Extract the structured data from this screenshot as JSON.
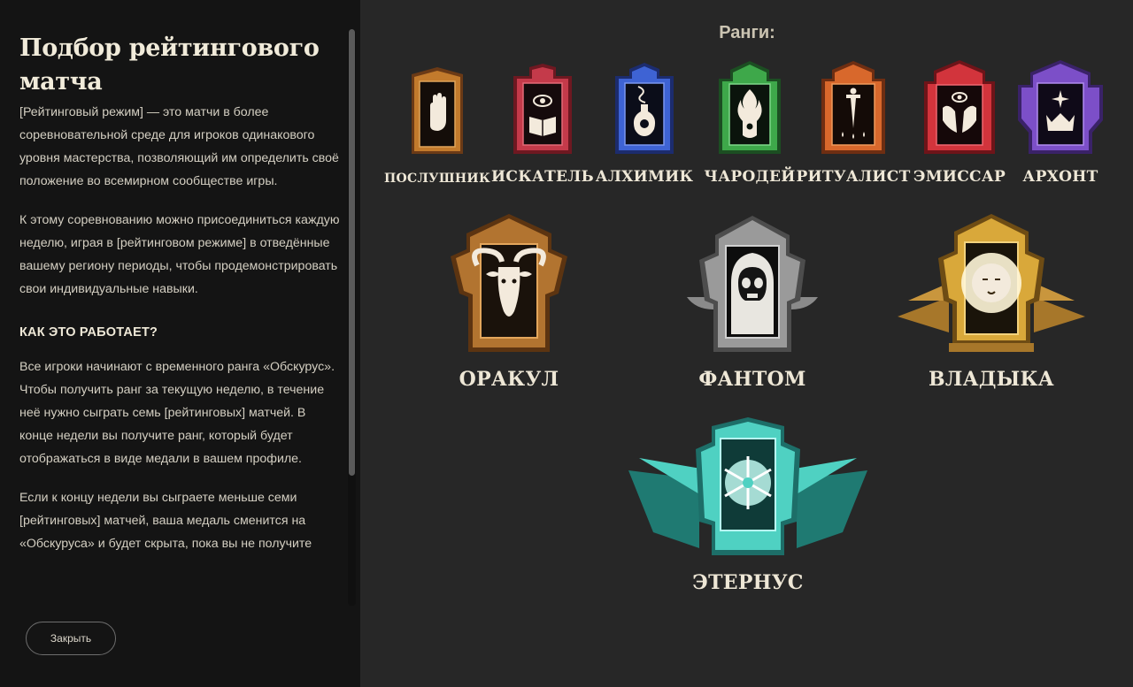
{
  "panel": {
    "title": "Подбор рейтингового матча",
    "intro": "[Рейтинговый режим] — это матчи в более соревновательной среде для игроков одинакового уровня мастерства, позволяющий им определить своё положение во всемирном сообществе игры.",
    "join": "К этому соревнованию можно присоединиться каждую неделю, играя в [рейтинговом режиме] в отведённые вашему региону периоды, чтобы продемонстрировать свои индивидуальные навыки.",
    "how_heading": "КАК ЭТО РАБОТАЕТ?",
    "how_text": "Все игроки начинают с временного ранга «Обскурус». Чтобы получить ранг за текущую неделю, в течение неё нужно сыграть семь [рейтинговых] матчей. В конце недели вы получите ранг, который будет отображаться в виде медали в вашем профиле.",
    "less_text": "Если к концу недели вы сыграете меньше семи [рейтинговых] матчей, ваша медаль сменится на «Обскуруса» и будет скрыта, пока вы не получите",
    "close_label": "Закрыть"
  },
  "ranks": {
    "title": "Ранги:",
    "small": [
      {
        "label": "ПОСЛУШНИК",
        "icon": "palm-icon",
        "color": "#c27a2c"
      },
      {
        "label": "ИСКАТЕЛЬ",
        "icon": "eye-book-icon",
        "color": "#c43a4a"
      },
      {
        "label": "АЛХИМИК",
        "icon": "flask-icon",
        "color": "#3e63d4"
      },
      {
        "label": "ЧАРОДЕЙ",
        "icon": "flame-hand-icon",
        "color": "#3ea84a"
      },
      {
        "label": "РИТУАЛИСТ",
        "icon": "dagger-icon",
        "color": "#d8682c"
      },
      {
        "label": "ЭМИССАР",
        "icon": "hands-eye-icon",
        "color": "#d2343c"
      },
      {
        "label": "АРХОНТ",
        "icon": "crown-icon",
        "color": "#7c4fc8"
      }
    ],
    "big": [
      {
        "label": "ОРАКУЛ",
        "icon": "goat-icon",
        "color": "#b27430"
      },
      {
        "label": "ФАНТОМ",
        "icon": "skull-hood-icon",
        "color": "#9a9a9a"
      },
      {
        "label": "ВЛАДЫКА",
        "icon": "sun-face-icon",
        "color": "#d9a83a"
      }
    ],
    "top": {
      "label": "ЭТЕРНУС",
      "icon": "snowflake-icon",
      "color": "#4fd1c2"
    }
  }
}
